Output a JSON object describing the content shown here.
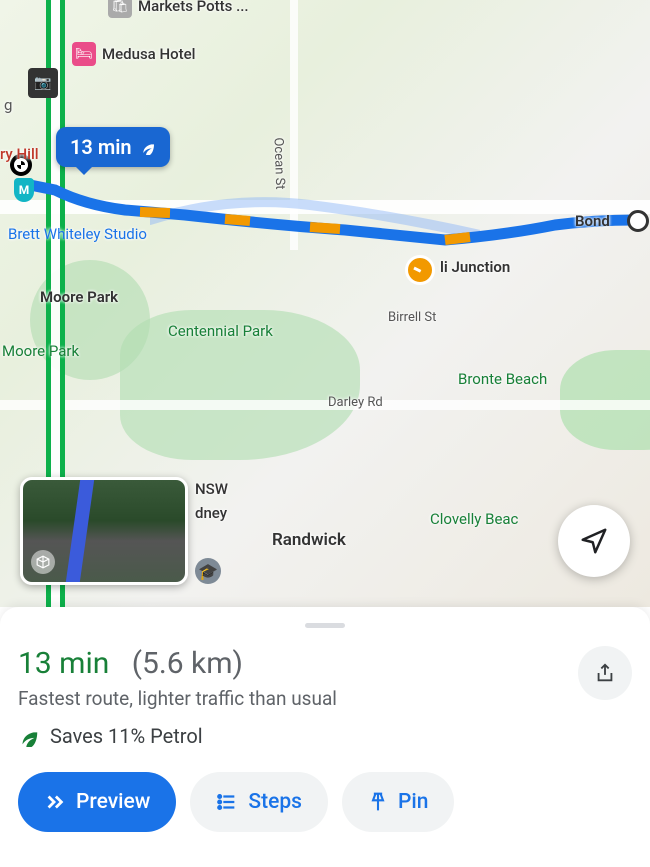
{
  "route_badge": {
    "time": "13 min"
  },
  "places": {
    "markets": "Markets Potts ...",
    "medusa": "Medusa Hotel",
    "hill": "ry Hill",
    "brett": "Brett Whiteley Studio",
    "moore1": "Moore Park",
    "moore2": "Moore Park",
    "centennial": "Centennial Park",
    "junction": "li Junction",
    "nsw": "NSW",
    "dney": "dney",
    "randwick": "Randwick",
    "bronte": "Bronte Beach",
    "clovelly": "Clovelly Beac",
    "bondi": "Bond",
    "g": "g"
  },
  "streets": {
    "ocean": "Ocean St",
    "birrell": "Birrell St",
    "darley": "Darley Rd"
  },
  "sheet": {
    "time": "13 min",
    "distance": "(5.6 km)",
    "subtitle": "Fastest route, lighter traffic than usual",
    "eco": "Saves 11% Petrol"
  },
  "actions": {
    "preview": "Preview",
    "steps": "Steps",
    "pin": "Pin"
  }
}
